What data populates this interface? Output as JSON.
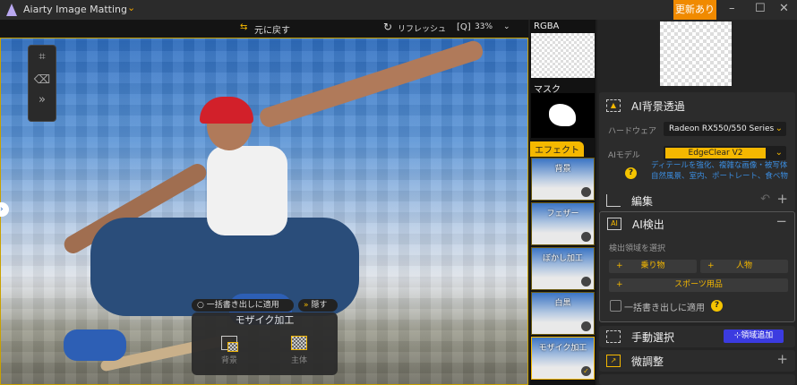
{
  "app": {
    "title": "Aiarty Image Matting",
    "update_label": "更新あり",
    "window_controls": [
      "minimize",
      "maximize",
      "close"
    ]
  },
  "toolbar": {
    "undo_label": "元に戻す",
    "refresh_label": "リフレッシュ",
    "zoom": "33%"
  },
  "canvas": {
    "batch_apply_label": "一括書き出しに適用",
    "hide_label": "隠す",
    "mosaic_panel": {
      "title": "モザイク加工",
      "options": [
        "背景",
        "主体"
      ]
    }
  },
  "thumbnails": {
    "rgba_label": "RGBA",
    "mask_label": "マスク",
    "effect_label": "エフェクト",
    "effects": [
      {
        "label": "背景",
        "selected": false
      },
      {
        "label": "フェザー",
        "selected": false
      },
      {
        "label": "ぼかし加工",
        "selected": false
      },
      {
        "label": "白黒",
        "selected": false
      },
      {
        "label": "モザイク加工",
        "selected": true
      }
    ]
  },
  "panel": {
    "bg_removal": {
      "title": "AI背景透過",
      "hardware_label": "ハードウェア",
      "hardware_value": "Radeon RX550/550 Series",
      "model_label": "AIモデル",
      "model_value": "EdgeClear  V2",
      "model_desc_1": "ディテールを強化、複雑な画像・被写体",
      "model_desc_2": "自然風景、室内、ポートレート、食べ物"
    },
    "edit": {
      "title": "編集"
    },
    "ai_detect": {
      "title": "AI検出",
      "select_label": "検出領域を選択",
      "chips": [
        "乗り物",
        "人物",
        "スポーツ用品"
      ],
      "batch_label": "一括書き出しに適用"
    },
    "manual": {
      "title": "手動選択",
      "add_label": "領域追加"
    },
    "fine_tune": {
      "title": "微調整"
    }
  },
  "colors": {
    "accent": "#f5b800",
    "update": "#f08a00",
    "add_button": "#3b3be0",
    "link": "#3b8de0"
  }
}
